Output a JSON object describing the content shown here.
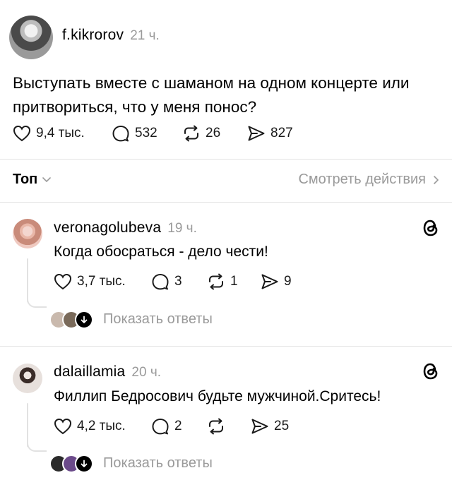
{
  "post": {
    "author": "f.kikrorov",
    "time": "21 ч.",
    "text_line1": "Выступать вместе с шаманом на одном концерте или",
    "text_line2": "притвориться, что у меня понос?",
    "likes": "9,4 тыс.",
    "comments": "532",
    "reposts": "26",
    "shares": "827"
  },
  "sort_bar": {
    "sort_label": "Топ",
    "activity_link": "Смотреть действия"
  },
  "replies": [
    {
      "author": "veronagolubeva",
      "time": "19 ч.",
      "text": "Когда обосраться - дело чести!",
      "likes": "3,7 тыс.",
      "comments": "3",
      "reposts": "1",
      "shares": "9",
      "show_replies": "Показать ответы"
    },
    {
      "author": "dalaillamia",
      "time": "20 ч.",
      "text": "Филлип Бедросович будьте мужчиной.Сритесь!",
      "likes": "4,2 тыс.",
      "comments": "2",
      "reposts": "",
      "shares": "25",
      "show_replies": "Показать ответы"
    }
  ],
  "icons": {
    "like": "heart-icon",
    "comment": "speech-bubble-icon",
    "repost": "repost-icon",
    "share": "send-icon",
    "threads": "threads-logo-icon",
    "chevron_down": "chevron-down-icon",
    "chevron_right": "chevron-right-icon"
  },
  "colors": {
    "text": "#000000",
    "muted": "#9a9a9a",
    "divider": "#e3e3e3"
  }
}
